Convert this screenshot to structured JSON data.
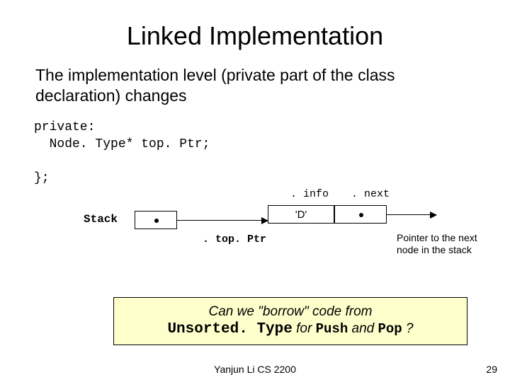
{
  "title": "Linked Implementation",
  "lead": "The implementation level (private part of the class declaration) changes",
  "code": "private:\n  Node. Type* top. Ptr;\n\n};",
  "diagram": {
    "stack_label": "Stack",
    "info_label": ". info",
    "next_label": ". next",
    "node_value": "'D'",
    "topptr_label": ". top. Ptr",
    "pointer_caption": "Pointer to the next node in the stack"
  },
  "question": {
    "pre": "Can we \"borrow\" code from",
    "type_name": "Unsorted. Type",
    "mid1": " for ",
    "push": "Push",
    "mid2": " and ",
    "pop": "Pop",
    "end": " ?"
  },
  "footer": {
    "author": "Yanjun Li CS 2200",
    "page": "29"
  }
}
